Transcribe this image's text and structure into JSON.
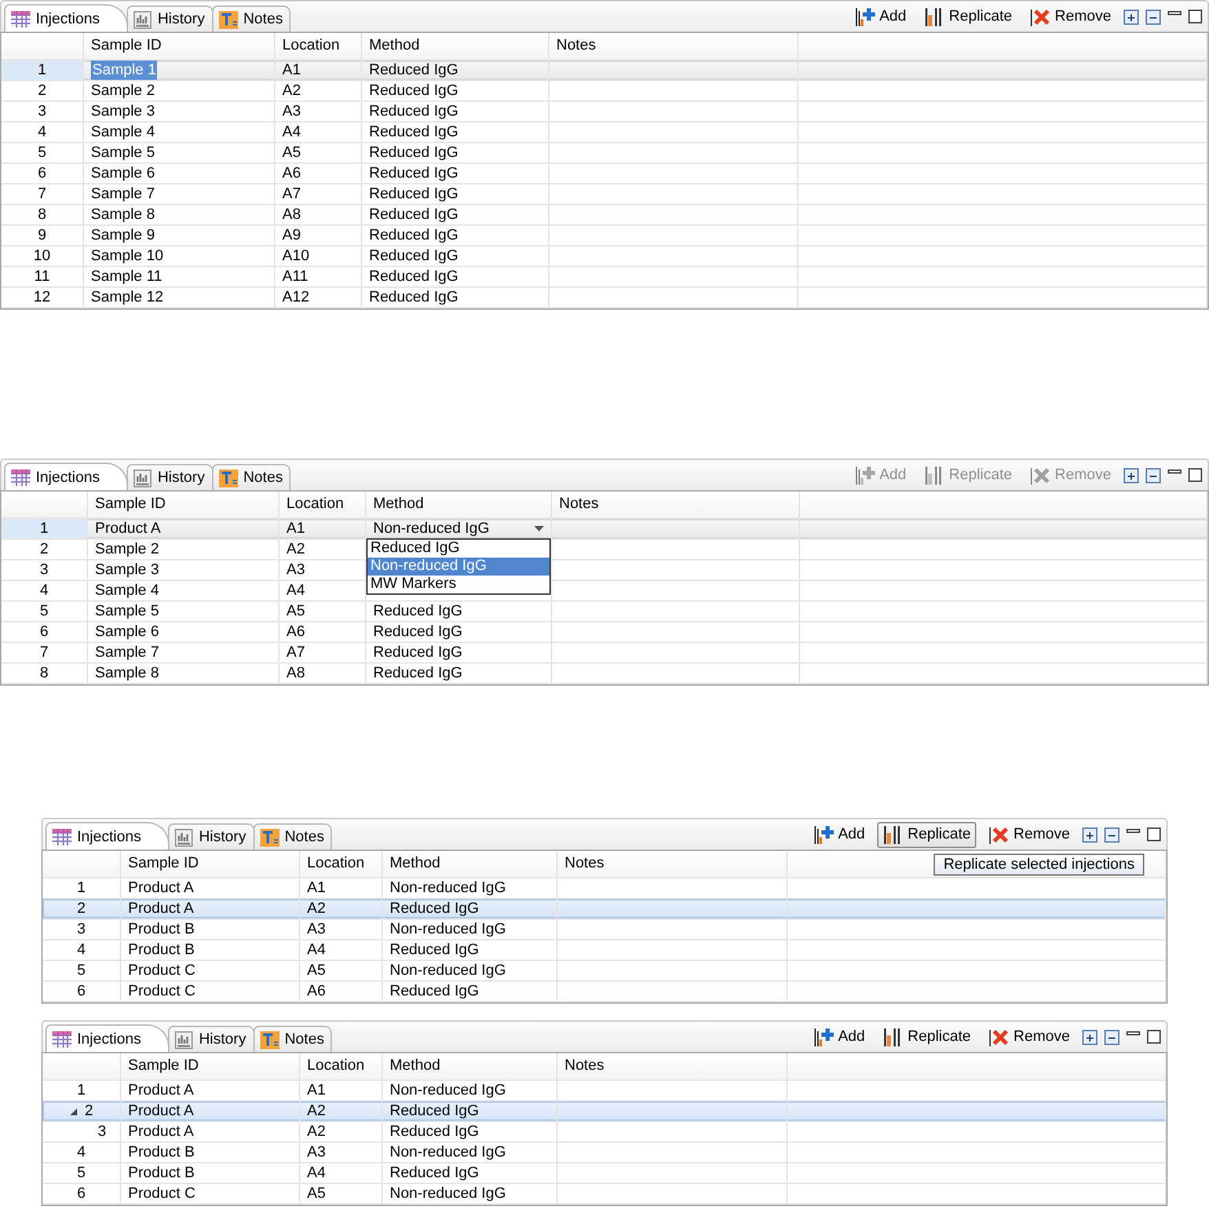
{
  "panels": [
    {
      "tabs": [
        {
          "kind": "table",
          "label": "Injections",
          "selected": true
        },
        {
          "kind": "history",
          "label": "History",
          "selected": false
        },
        {
          "kind": "notes",
          "label": "Notes",
          "selected": false
        }
      ],
      "toolbar": [
        {
          "kind": "add",
          "label": "Add",
          "disabled": false,
          "pressed": false
        },
        {
          "kind": "replicate",
          "label": "Replicate",
          "disabled": false,
          "pressed": false
        },
        {
          "kind": "remove",
          "label": "Remove",
          "disabled": false,
          "pressed": false
        }
      ],
      "columns": [
        "Sample ID",
        "Location",
        "Method",
        "Notes"
      ],
      "rows": [
        {
          "number": "1",
          "sample_id": "Sample 1",
          "location": "A1",
          "method": "Reduced IgG",
          "selected": true,
          "editing": true,
          "sample_id_highlighted": true
        },
        {
          "number": "2",
          "sample_id": "Sample 2",
          "location": "A2",
          "method": "Reduced IgG",
          "selected": false
        },
        {
          "number": "3",
          "sample_id": "Sample 3",
          "location": "A3",
          "method": "Reduced IgG",
          "selected": false
        },
        {
          "number": "4",
          "sample_id": "Sample 4",
          "location": "A4",
          "method": "Reduced IgG",
          "selected": false
        },
        {
          "number": "5",
          "sample_id": "Sample 5",
          "location": "A5",
          "method": "Reduced IgG",
          "selected": false
        },
        {
          "number": "6",
          "sample_id": "Sample 6",
          "location": "A6",
          "method": "Reduced IgG",
          "selected": false
        },
        {
          "number": "7",
          "sample_id": "Sample 7",
          "location": "A7",
          "method": "Reduced IgG",
          "selected": false
        },
        {
          "number": "8",
          "sample_id": "Sample 8",
          "location": "A8",
          "method": "Reduced IgG",
          "selected": false
        },
        {
          "number": "9",
          "sample_id": "Sample 9",
          "location": "A9",
          "method": "Reduced IgG",
          "selected": false
        },
        {
          "number": "10",
          "sample_id": "Sample 10",
          "location": "A10",
          "method": "Reduced IgG",
          "selected": false
        },
        {
          "number": "11",
          "sample_id": "Sample 11",
          "location": "A11",
          "method": "Reduced IgG",
          "selected": false
        },
        {
          "number": "12",
          "sample_id": "Sample 12",
          "location": "A12",
          "method": "Reduced IgG",
          "selected": false
        }
      ]
    },
    {
      "tabs": [
        {
          "kind": "table",
          "label": "Injections",
          "selected": true
        },
        {
          "kind": "history",
          "label": "History",
          "selected": false
        },
        {
          "kind": "notes",
          "label": "Notes",
          "selected": false
        }
      ],
      "toolbar": [
        {
          "kind": "add",
          "label": "Add",
          "disabled": true,
          "pressed": false
        },
        {
          "kind": "replicate",
          "label": "Replicate",
          "disabled": true,
          "pressed": false
        },
        {
          "kind": "remove",
          "label": "Remove",
          "disabled": true,
          "pressed": false
        }
      ],
      "columns": [
        "Sample ID",
        "Location",
        "Method",
        "Notes"
      ],
      "rows": [
        {
          "number": "1",
          "sample_id": "Product A",
          "location": "A1",
          "method": "Non-reduced IgG",
          "selected": true,
          "editing": true,
          "dropdown": {
            "options": [
              {
                "label": "Reduced IgG",
                "selected": false
              },
              {
                "label": "Non-reduced IgG",
                "selected": true
              },
              {
                "label": "MW Markers",
                "selected": false
              }
            ]
          }
        },
        {
          "number": "2",
          "sample_id": "Sample 2",
          "location": "A2",
          "selected": false
        },
        {
          "number": "3",
          "sample_id": "Sample 3",
          "location": "A3",
          "selected": false
        },
        {
          "number": "4",
          "sample_id": "Sample 4",
          "location": "A4",
          "selected": false
        },
        {
          "number": "5",
          "sample_id": "Sample 5",
          "location": "A5",
          "method": "Reduced IgG",
          "selected": false
        },
        {
          "number": "6",
          "sample_id": "Sample 6",
          "location": "A6",
          "method": "Reduced IgG",
          "selected": false
        },
        {
          "number": "7",
          "sample_id": "Sample 7",
          "location": "A7",
          "method": "Reduced IgG",
          "selected": false
        },
        {
          "number": "8",
          "sample_id": "Sample 8",
          "location": "A8",
          "method": "Reduced IgG",
          "selected": false
        }
      ]
    },
    {
      "tabs": [
        {
          "kind": "table",
          "label": "Injections",
          "selected": true
        },
        {
          "kind": "history",
          "label": "History",
          "selected": false
        },
        {
          "kind": "notes",
          "label": "Notes",
          "selected": false
        }
      ],
      "toolbar": [
        {
          "kind": "add",
          "label": "Add",
          "disabled": false,
          "pressed": false
        },
        {
          "kind": "replicate",
          "label": "Replicate",
          "disabled": false,
          "pressed": true
        },
        {
          "kind": "remove",
          "label": "Remove",
          "disabled": false,
          "pressed": false
        }
      ],
      "tooltip": "Replicate selected injections",
      "columns": [
        "Sample ID",
        "Location",
        "Method",
        "Notes"
      ],
      "rows": [
        {
          "number": "1",
          "sample_id": "Product A",
          "location": "A1",
          "method": "Non-reduced IgG",
          "selected": false
        },
        {
          "number": "2",
          "sample_id": "Product A",
          "location": "A2",
          "method": "Reduced IgG",
          "selected": true
        },
        {
          "number": "3",
          "sample_id": "Product B",
          "location": "A3",
          "method": "Non-reduced IgG",
          "selected": false
        },
        {
          "number": "4",
          "sample_id": "Product B",
          "location": "A4",
          "method": "Reduced IgG",
          "selected": false
        },
        {
          "number": "5",
          "sample_id": "Product C",
          "location": "A5",
          "method": "Non-reduced IgG",
          "selected": false
        },
        {
          "number": "6",
          "sample_id": "Product C",
          "location": "A6",
          "method": "Reduced IgG",
          "selected": false
        }
      ]
    },
    {
      "tabs": [
        {
          "kind": "table",
          "label": "Injections",
          "selected": true
        },
        {
          "kind": "history",
          "label": "History",
          "selected": false
        },
        {
          "kind": "notes",
          "label": "Notes",
          "selected": false
        }
      ],
      "toolbar": [
        {
          "kind": "add",
          "label": "Add",
          "disabled": false,
          "pressed": false
        },
        {
          "kind": "replicate",
          "label": "Replicate",
          "disabled": false,
          "pressed": false
        },
        {
          "kind": "remove",
          "label": "Remove",
          "disabled": false,
          "pressed": false
        }
      ],
      "columns": [
        "Sample ID",
        "Location",
        "Method",
        "Notes"
      ],
      "rows": [
        {
          "number": "1",
          "sample_id": "Product A",
          "location": "A1",
          "method": "Non-reduced IgG",
          "selected": false
        },
        {
          "number": "2",
          "sample_id": "Product A",
          "location": "A2",
          "method": "Reduced IgG",
          "selected": true,
          "expanded": true,
          "children": [
            {
              "number": "3",
              "sample_id": "Product A",
              "location": "A2",
              "method": "Reduced IgG",
              "selected": false
            }
          ]
        },
        {
          "number": "4",
          "sample_id": "Product B",
          "location": "A3",
          "method": "Non-reduced IgG",
          "selected": false
        },
        {
          "number": "5",
          "sample_id": "Product B",
          "location": "A4",
          "method": "Reduced IgG",
          "selected": false
        },
        {
          "number": "6",
          "sample_id": "Product C",
          "location": "A5",
          "method": "Non-reduced IgG",
          "selected": false
        }
      ]
    }
  ]
}
